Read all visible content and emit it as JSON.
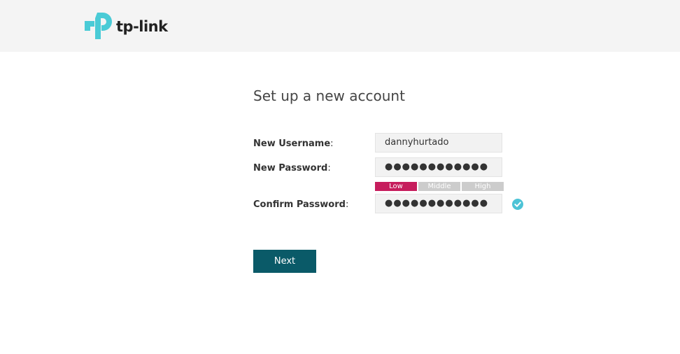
{
  "header": {
    "logo_text": "tp-link",
    "logo_icon": "tp-link-logo-icon",
    "brand_color": "#4acbd6"
  },
  "page": {
    "title": "Set up a new account"
  },
  "form": {
    "username": {
      "label": "New Username",
      "colon": ":",
      "value": "dannyhurtado"
    },
    "password": {
      "label": "New Password",
      "colon": ":",
      "value": "●●●●●●●●●●●●"
    },
    "strength": {
      "levels": [
        "Low",
        "Middle",
        "High"
      ],
      "current": "Low",
      "active_color": "#c61d5d",
      "inactive_color": "#cccccc"
    },
    "confirm": {
      "label": "Confirm Password",
      "colon": ":",
      "value": "●●●●●●●●●●●●",
      "status_icon": "check-circle-icon",
      "status_color": "#4cc3d6"
    }
  },
  "actions": {
    "next_label": "Next",
    "next_color": "#0a5a68"
  }
}
